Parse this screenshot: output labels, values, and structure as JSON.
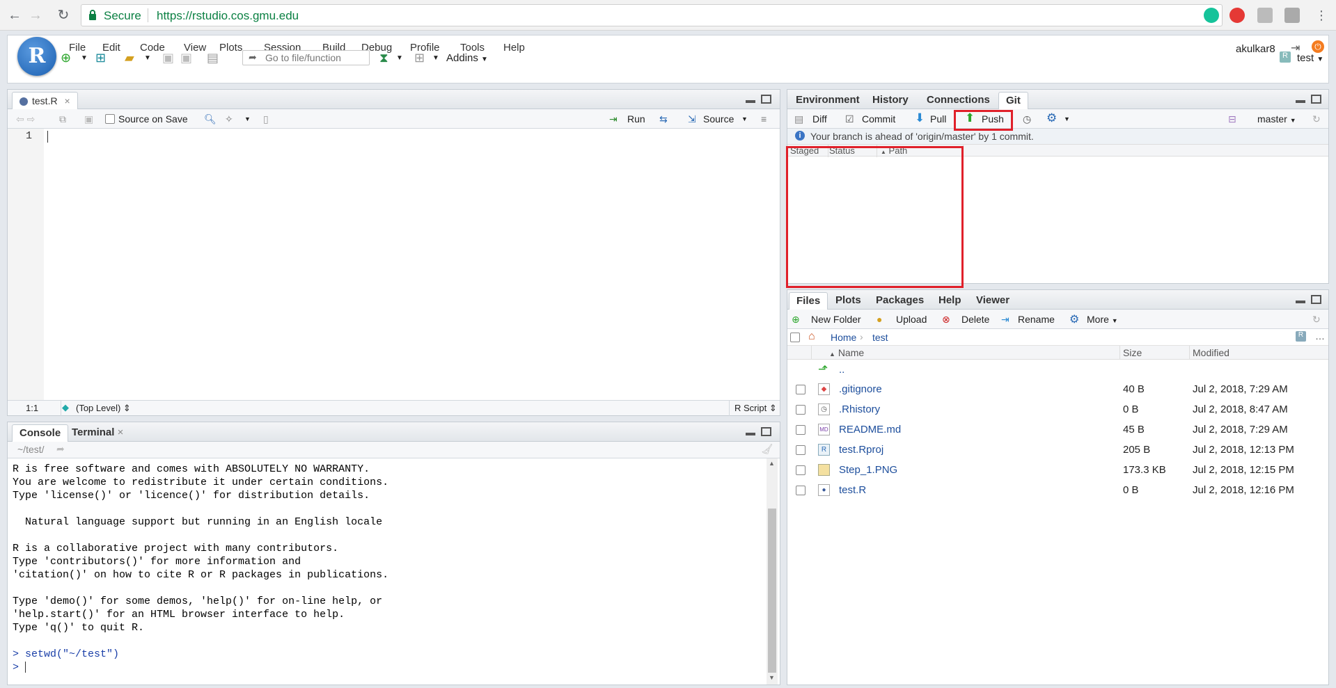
{
  "browser": {
    "secure_label": "Secure",
    "url": "https://rstudio.cos.gmu.edu"
  },
  "menu": [
    "File",
    "Edit",
    "Code",
    "View",
    "Plots",
    "Session",
    "Build",
    "Debug",
    "Profile",
    "Tools",
    "Help"
  ],
  "user": "akulkar8",
  "project": "test",
  "toolbar": {
    "goto_placeholder": "Go to file/function",
    "addins": "Addins"
  },
  "editor": {
    "tab": "test.R",
    "source_on_save": "Source on Save",
    "run": "Run",
    "source": "Source",
    "line_no": "1",
    "position": "1:1",
    "scope": "(Top Level)",
    "filetype": "R Script"
  },
  "console": {
    "tabs": [
      "Console",
      "Terminal"
    ],
    "path": "~/test/",
    "lines": [
      "R is free software and comes with ABSOLUTELY NO WARRANTY.",
      "You are welcome to redistribute it under certain conditions.",
      "Type 'license()' or 'licence()' for distribution details.",
      "",
      "  Natural language support but running in an English locale",
      "",
      "R is a collaborative project with many contributors.",
      "Type 'contributors()' for more information and",
      "'citation()' on how to cite R or R packages in publications.",
      "",
      "Type 'demo()' for some demos, 'help()' for on-line help, or",
      "'help.start()' for an HTML browser interface to help.",
      "Type 'q()' to quit R.",
      ""
    ],
    "command": "setwd(\"~/test\")",
    "prompt": ">"
  },
  "envpane": {
    "tabs": [
      "Environment",
      "History",
      "Connections",
      "Git"
    ],
    "git_buttons": {
      "diff": "Diff",
      "commit": "Commit",
      "pull": "Pull",
      "push": "Push"
    },
    "branch": "master",
    "info": "Your branch is ahead of 'origin/master' by 1 commit.",
    "columns": [
      "Staged",
      "Status",
      "Path"
    ]
  },
  "filespane": {
    "tabs": [
      "Files",
      "Plots",
      "Packages",
      "Help",
      "Viewer"
    ],
    "buttons": {
      "new_folder": "New Folder",
      "upload": "Upload",
      "delete": "Delete",
      "rename": "Rename",
      "more": "More"
    },
    "breadcrumb": [
      "Home",
      "test"
    ],
    "columns": {
      "name": "Name",
      "size": "Size",
      "modified": "Modified"
    },
    "parent": "..",
    "files": [
      {
        "name": ".gitignore",
        "size": "40 B",
        "modified": "Jul 2, 2018, 7:29 AM",
        "icon": "gitignore-icon"
      },
      {
        "name": ".Rhistory",
        "size": "0 B",
        "modified": "Jul 2, 2018, 8:47 AM",
        "icon": "history-file-icon"
      },
      {
        "name": "README.md",
        "size": "45 B",
        "modified": "Jul 2, 2018, 7:29 AM",
        "icon": "markdown-icon"
      },
      {
        "name": "test.Rproj",
        "size": "205 B",
        "modified": "Jul 2, 2018, 12:13 PM",
        "icon": "rproj-icon"
      },
      {
        "name": "Step_1.PNG",
        "size": "173.3 KB",
        "modified": "Jul 2, 2018, 12:15 PM",
        "icon": "image-file-icon"
      },
      {
        "name": "test.R",
        "size": "0 B",
        "modified": "Jul 2, 2018, 12:16 PM",
        "icon": "r-file-icon"
      }
    ]
  }
}
